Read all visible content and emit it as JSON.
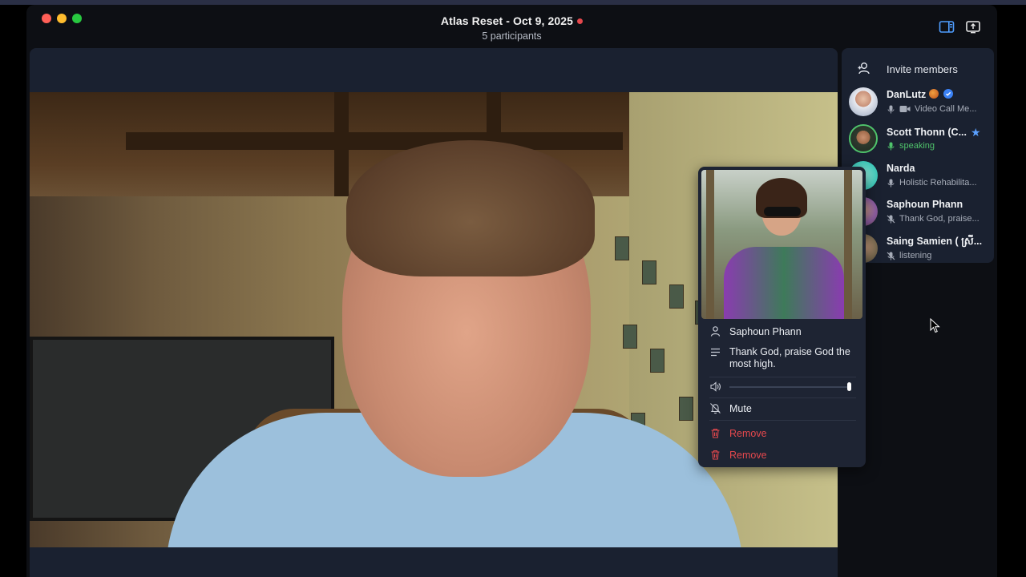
{
  "window": {
    "title": "Atlas Reset - Oct 9, 2025",
    "subtitle": "5 participants",
    "recording_color": "#e5484d"
  },
  "toolbar": {
    "sidebar_icon": "sidebar-toggle-icon",
    "share_icon": "screen-share-icon"
  },
  "sidebar": {
    "invite_label": "Invite members",
    "members": [
      {
        "name": "DanLutz",
        "status": "Video Call Me...",
        "status_type": "normal",
        "badges": [
          "emoji",
          "verified"
        ]
      },
      {
        "name": "Scott Thonn (C...",
        "status": "speaking",
        "status_type": "speaking",
        "badges": [
          "star"
        ]
      },
      {
        "name": "Narda",
        "status": "Holistic Rehabilita...",
        "status_type": "normal",
        "badges": []
      },
      {
        "name": "Saphoun Phann",
        "status": "Thank God, praise...",
        "status_type": "muted",
        "badges": []
      },
      {
        "name": "Saing Samien ( ស្រី...",
        "status": "listening",
        "status_type": "muted",
        "badges": []
      }
    ]
  },
  "popup": {
    "name": "Saphoun Phann",
    "bio": "Thank God, praise God the most high.",
    "volume_percent": 100,
    "mute_label": "Mute",
    "remove_label_1": "Remove",
    "remove_label_2": "Remove"
  },
  "colors": {
    "speaking": "#4fc36b",
    "danger": "#e5484d",
    "accent": "#3b82f6"
  }
}
